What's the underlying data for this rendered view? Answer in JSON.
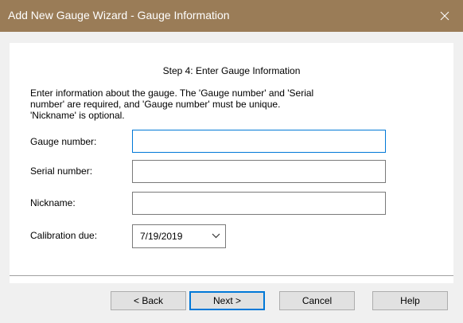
{
  "window": {
    "title": "Add New Gauge Wizard - Gauge Information",
    "close_icon": "close-icon"
  },
  "content": {
    "step_title": "Step 4: Enter Gauge Information",
    "intro_lines": [
      "Enter information about the gauge. The 'Gauge number' and 'Serial",
      "number' are required, and 'Gauge number' must be unique.",
      "'Nickname' is optional."
    ]
  },
  "form": {
    "gauge_number": {
      "label": "Gauge number:",
      "value": ""
    },
    "serial_number": {
      "label": "Serial number:",
      "value": ""
    },
    "nickname": {
      "label": "Nickname:",
      "value": ""
    },
    "calibration_due": {
      "label": "Calibration due:",
      "value": "7/19/2019",
      "icon": "chevron-down-icon"
    }
  },
  "buttons": {
    "back": "< Back",
    "next": "Next >",
    "cancel": "Cancel",
    "help": "Help"
  },
  "colors": {
    "title_bar": "#9a7c57",
    "focus_accent": "#0078d7",
    "dialog_background": "#f0f0f0"
  }
}
